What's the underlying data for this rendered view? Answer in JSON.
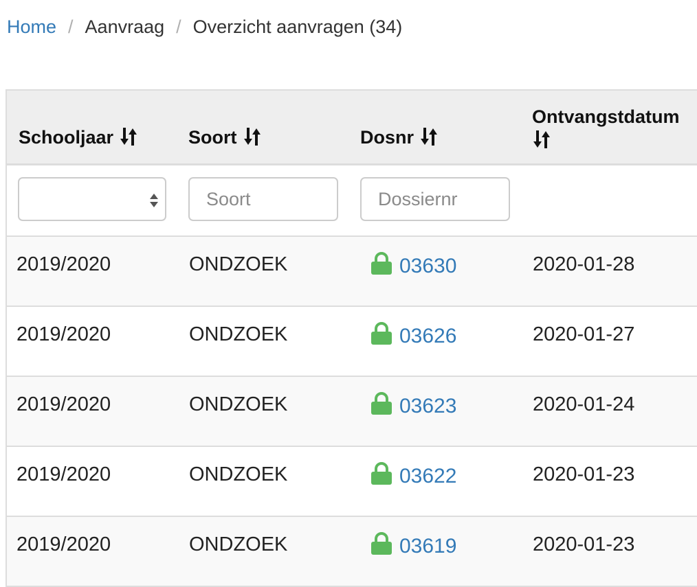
{
  "breadcrumb": {
    "home": "Home",
    "separator": "/",
    "level1": "Aanvraag",
    "current": "Overzicht aanvragen (34)"
  },
  "table": {
    "columns": {
      "schooljaar": "Schooljaar",
      "soort": "Soort",
      "dosnr": "Dosnr",
      "ontvangstdatum": "Ontvangstdatum"
    },
    "filters": {
      "schooljaar_value": "",
      "soort_placeholder": "Soort",
      "dosnr_placeholder": "Dossiernr"
    },
    "rows": [
      {
        "schooljaar": "2019/2020",
        "soort": "ONDZOEK",
        "dosnr": "03630",
        "ontvangstdatum": "2020-01-28"
      },
      {
        "schooljaar": "2019/2020",
        "soort": "ONDZOEK",
        "dosnr": "03626",
        "ontvangstdatum": "2020-01-27"
      },
      {
        "schooljaar": "2019/2020",
        "soort": "ONDZOEK",
        "dosnr": "03623",
        "ontvangstdatum": "2020-01-24"
      },
      {
        "schooljaar": "2019/2020",
        "soort": "ONDZOEK",
        "dosnr": "03622",
        "ontvangstdatum": "2020-01-23"
      },
      {
        "schooljaar": "2019/2020",
        "soort": "ONDZOEK",
        "dosnr": "03619",
        "ontvangstdatum": "2020-01-23"
      }
    ]
  },
  "icons": {
    "sort": "sort-icon",
    "lock": "lock-icon",
    "select_arrows": "select-arrows-icon"
  },
  "colors": {
    "link": "#337ab7",
    "lock": "#5cb85c",
    "header_bg": "#eeeeee",
    "stripe_bg": "#f9f9f9"
  }
}
